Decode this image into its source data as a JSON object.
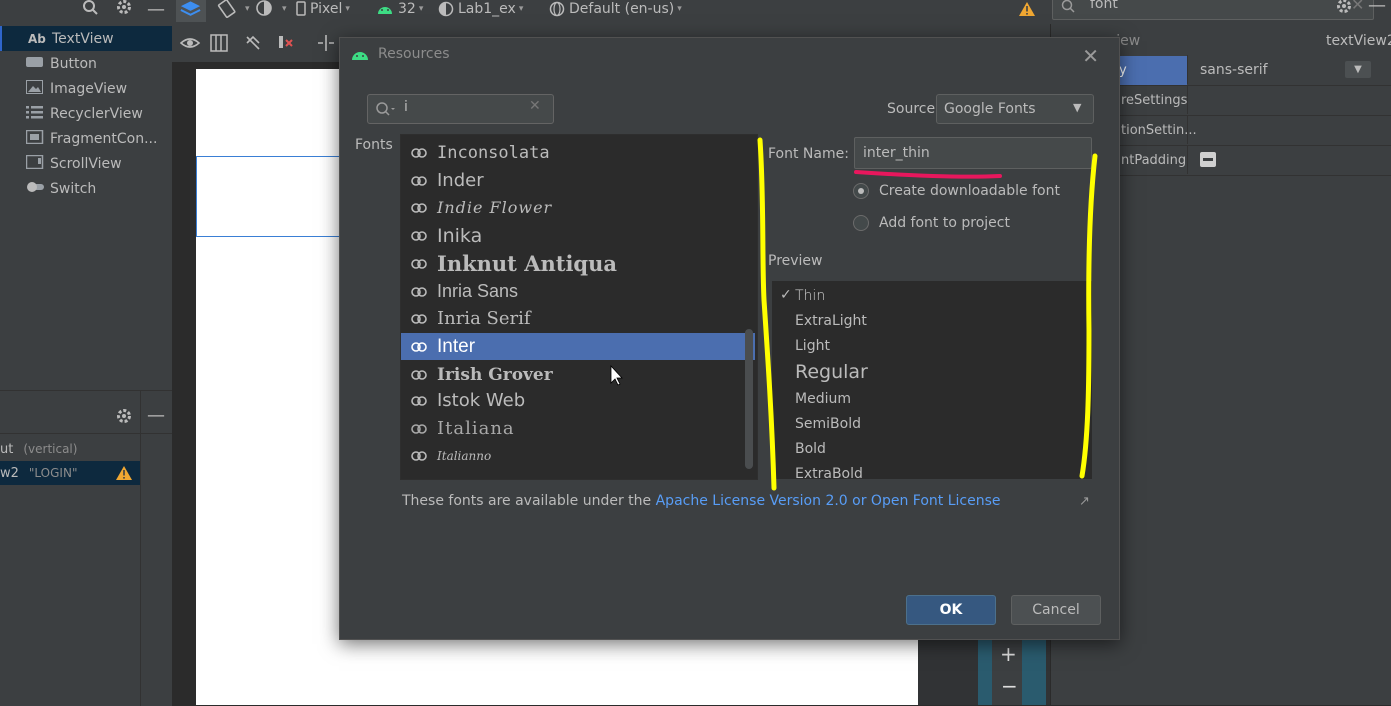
{
  "toolbar": {
    "device": "Pixel",
    "api_level": "32",
    "theme": "Lab1_ex",
    "locale": "Default (en-us)"
  },
  "attributes": {
    "search_value": "font",
    "selected_view": "textView2",
    "header_fragment": "view",
    "rows": [
      {
        "name": "y",
        "value": "sans-serif"
      },
      {
        "name": "reSettings",
        "value": ""
      },
      {
        "name": "tionSettin...",
        "value": ""
      },
      {
        "name": "ntPadding",
        "value": ""
      }
    ]
  },
  "palette": {
    "items": [
      {
        "icon": "Ab",
        "label": "TextView"
      },
      {
        "icon": "btn",
        "label": "Button"
      },
      {
        "icon": "img",
        "label": "ImageView"
      },
      {
        "icon": "list",
        "label": "RecyclerView"
      },
      {
        "icon": "frag",
        "label": "FragmentCon..."
      },
      {
        "icon": "scroll",
        "label": "ScrollView"
      },
      {
        "icon": "switch",
        "label": "Switch"
      }
    ]
  },
  "component_tree": {
    "rows": [
      {
        "name": "ut",
        "hint": "(vertical)"
      },
      {
        "name": "w2",
        "hint": "\"LOGIN\""
      }
    ]
  },
  "dialog": {
    "title": "Resources",
    "search_value": "i",
    "fonts_label": "Fonts",
    "source_label": "Source",
    "source_value": "Google Fonts",
    "font_name_label": "Font Name:",
    "font_name_value": "inter_thin",
    "radio_downloadable": "Create downloadable font",
    "radio_add": "Add font to project",
    "preview_label": "Preview",
    "font_list": [
      "Inconsolata",
      "Inder",
      "Indie Flower",
      "Inika",
      "Inknut Antiqua",
      "Inria Sans",
      "Inria Serif",
      "Inter",
      "Irish Grover",
      "Istok Web",
      "Italiana",
      "Italianno"
    ],
    "selected_font": "Inter",
    "preview_weights": [
      "Thin",
      "ExtraLight",
      "Light",
      "Regular",
      "Medium",
      "SemiBold",
      "Bold",
      "ExtraBold"
    ],
    "checked_weight": "Thin",
    "license_prefix": "These fonts are available under the ",
    "license_link": "Apache License Version 2.0 or Open Font License",
    "ok_label": "OK",
    "cancel_label": "Cancel"
  },
  "colors": {
    "selection": "#4b6eaf",
    "link": "#589df6",
    "annotation_yellow": "#ffff00",
    "annotation_red": "#e8175d"
  }
}
